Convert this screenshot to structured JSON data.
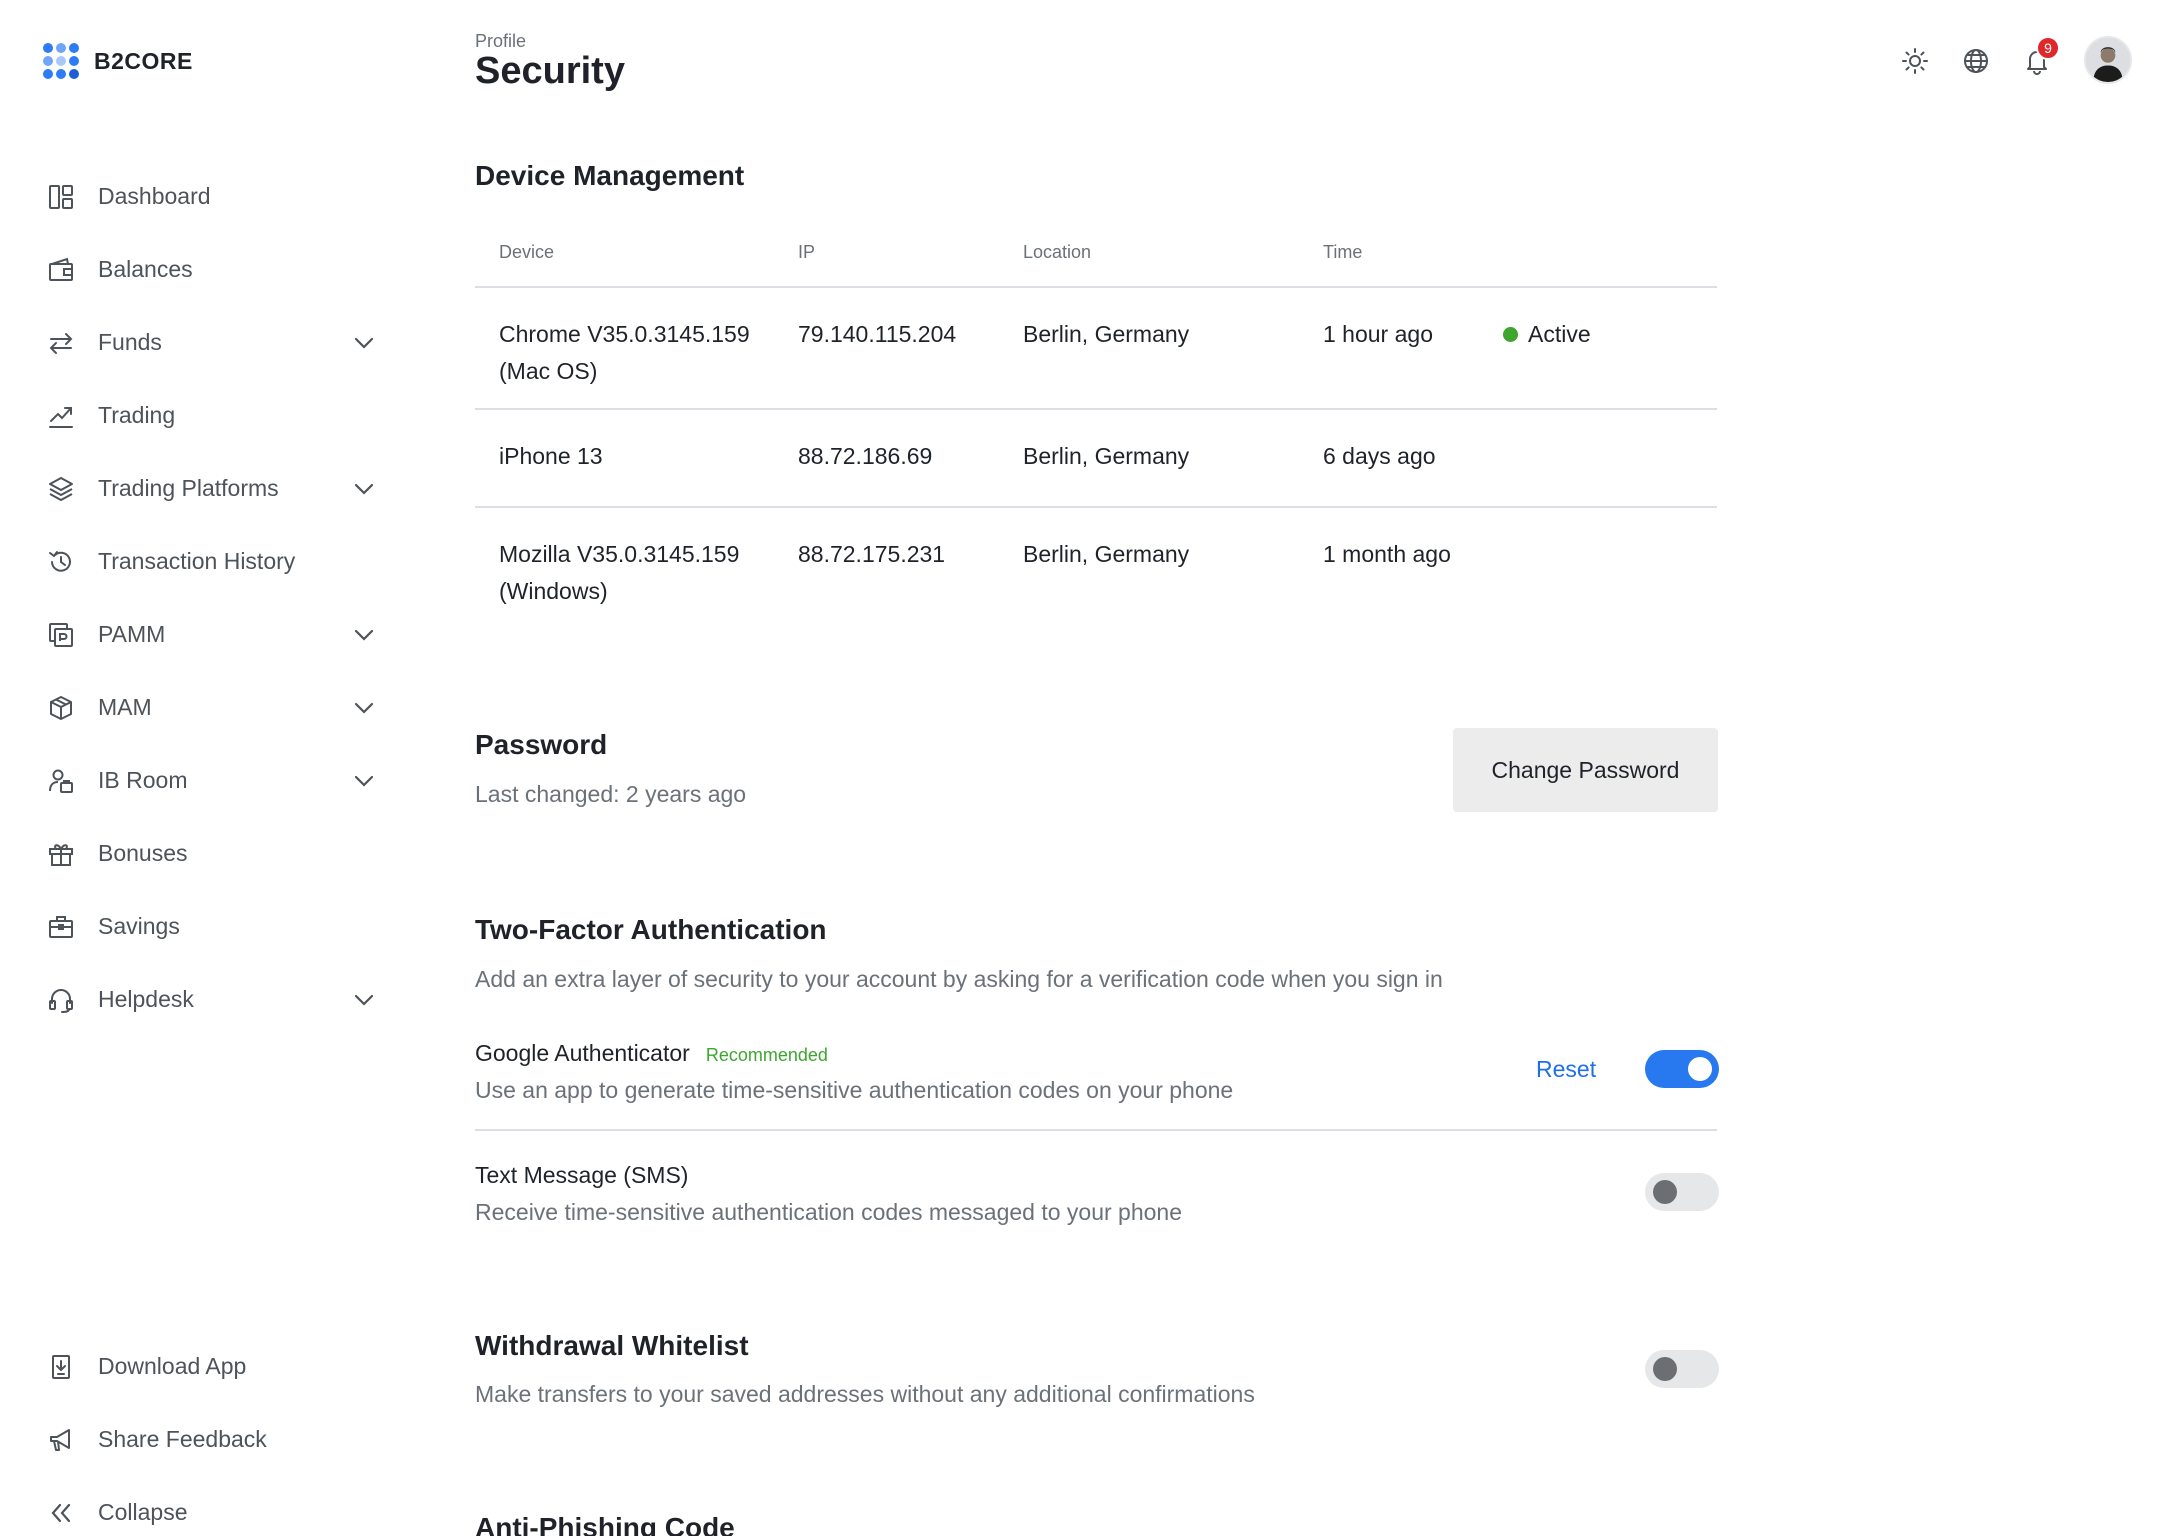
{
  "app": {
    "logo_text": "B2CORE"
  },
  "sidebar": {
    "items": [
      {
        "label": "Dashboard",
        "icon": "dashboard-icon",
        "has_chevron": false
      },
      {
        "label": "Balances",
        "icon": "wallet-icon",
        "has_chevron": false
      },
      {
        "label": "Funds",
        "icon": "transfer-arrows-icon",
        "has_chevron": true
      },
      {
        "label": "Trading",
        "icon": "trend-chart-icon",
        "has_chevron": false
      },
      {
        "label": "Trading Platforms",
        "icon": "layers-icon",
        "has_chevron": true
      },
      {
        "label": "Transaction History",
        "icon": "history-icon",
        "has_chevron": false
      },
      {
        "label": "PAMM",
        "icon": "pamm-icon",
        "has_chevron": true
      },
      {
        "label": "MAM",
        "icon": "box-icon",
        "has_chevron": true
      },
      {
        "label": "IB Room",
        "icon": "ib-room-icon",
        "has_chevron": true
      },
      {
        "label": "Bonuses",
        "icon": "gift-icon",
        "has_chevron": false
      },
      {
        "label": "Savings",
        "icon": "briefcase-icon",
        "has_chevron": false
      },
      {
        "label": "Helpdesk",
        "icon": "headset-icon",
        "has_chevron": true
      }
    ],
    "bottom_items": [
      {
        "label": "Download App",
        "icon": "download-app-icon"
      },
      {
        "label": "Share Feedback",
        "icon": "megaphone-icon"
      },
      {
        "label": "Collapse",
        "icon": "double-chevron-left-icon"
      }
    ]
  },
  "header": {
    "breadcrumb": "Profile",
    "title": "Security",
    "notification_count": "9"
  },
  "device_management": {
    "title": "Device Management",
    "columns": [
      "Device",
      "IP",
      "Location",
      "Time"
    ],
    "rows": [
      {
        "device_line1": "Chrome V35.0.3145.159",
        "device_line2": "(Mac OS)",
        "ip": "79.140.115.204",
        "location": "Berlin, Germany",
        "time": "1 hour ago",
        "status": "Active"
      },
      {
        "device_line1": "iPhone 13",
        "device_line2": "",
        "ip": "88.72.186.69",
        "location": "Berlin, Germany",
        "time": "6 days ago",
        "status": ""
      },
      {
        "device_line1": "Mozilla V35.0.3145.159",
        "device_line2": "(Windows)",
        "ip": "88.72.175.231",
        "location": "Berlin, Germany",
        "time": "1 month ago",
        "status": ""
      }
    ],
    "status_color": "#3da62e"
  },
  "password": {
    "title": "Password",
    "last_changed": "Last changed: 2 years ago",
    "button_label": "Change Password"
  },
  "two_factor": {
    "title": "Two-Factor Authentication",
    "description": "Add an extra layer of security to your account by asking for a verification code when you sign in",
    "google": {
      "title": "Google Authenticator",
      "tag": "Recommended",
      "description": "Use an app to generate time-sensitive authentication codes on your phone",
      "reset_label": "Reset",
      "enabled": true
    },
    "sms": {
      "title": "Text Message (SMS)",
      "description": "Receive time-sensitive authentication codes messaged to your phone",
      "enabled": false
    }
  },
  "withdrawal_whitelist": {
    "title": "Withdrawal Whitelist",
    "description": "Make transfers to your saved addresses without any additional confirmations",
    "enabled": false
  },
  "anti_phishing": {
    "title": "Anti-Phishing Code"
  },
  "colors": {
    "accent": "#2878f0",
    "link": "#1e6fe8",
    "success": "#3da62e",
    "badge": "#e0272b"
  }
}
